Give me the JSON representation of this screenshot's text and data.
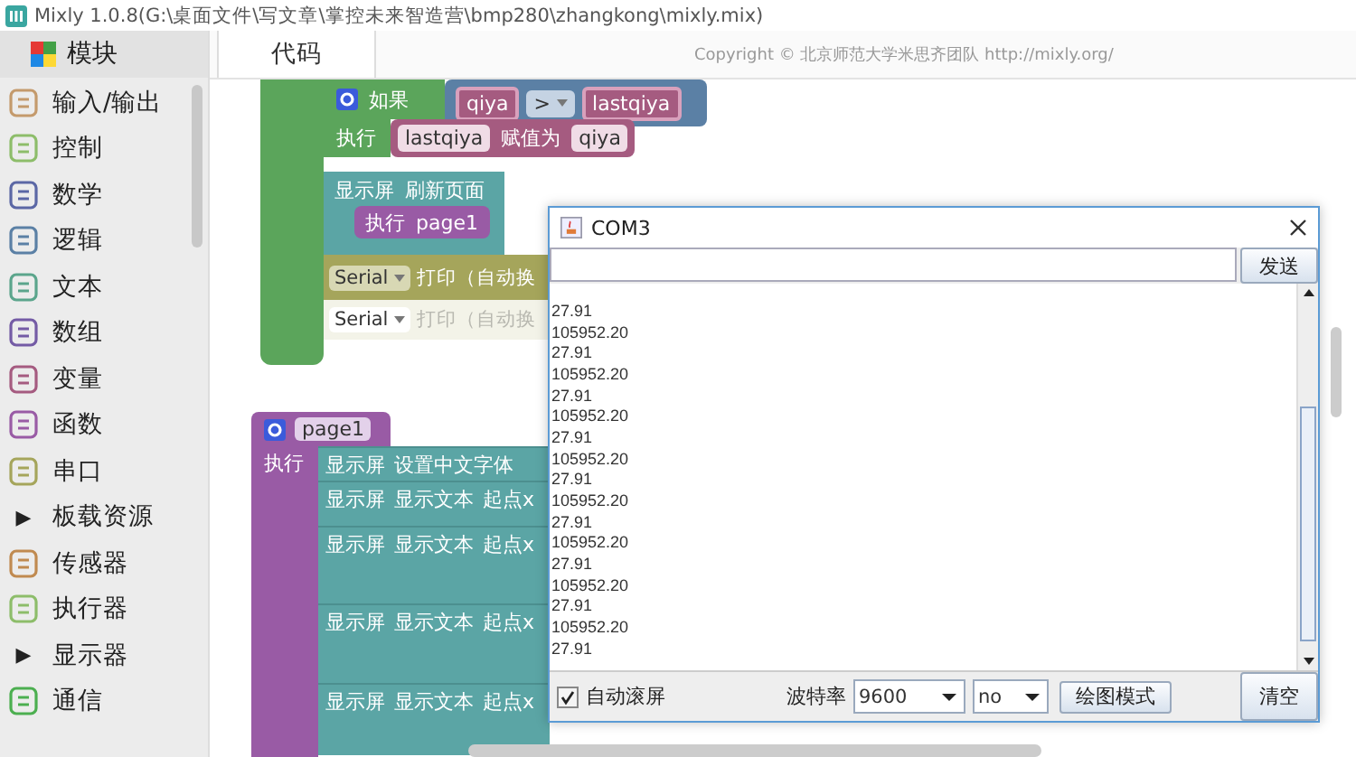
{
  "window": {
    "title": "Mixly 1.0.8(G:\\桌面文件\\写文章\\掌控未来智造营\\bmp280\\zhangkong\\mixly.mix)"
  },
  "sidebar": {
    "header": "模块",
    "items": [
      {
        "label": "输入/输出",
        "kind": "category",
        "color": "#c49a6c"
      },
      {
        "label": "控制",
        "kind": "category",
        "color": "#8dbd6a"
      },
      {
        "label": "数学",
        "kind": "category",
        "color": "#5b67a5"
      },
      {
        "label": "逻辑",
        "kind": "category",
        "color": "#5b80a5"
      },
      {
        "label": "文本",
        "kind": "category",
        "color": "#5ba58c"
      },
      {
        "label": "数组",
        "kind": "category",
        "color": "#745ba5"
      },
      {
        "label": "变量",
        "kind": "category",
        "color": "#a55b80"
      },
      {
        "label": "函数",
        "kind": "category",
        "color": "#995ba5"
      },
      {
        "label": "串口",
        "kind": "category",
        "color": "#a5a55b"
      },
      {
        "label": "板载资源",
        "kind": "folder",
        "arrow": "▶"
      },
      {
        "label": "传感器",
        "kind": "category",
        "color": "#c08a50"
      },
      {
        "label": "执行器",
        "kind": "category",
        "color": "#8dbd6a"
      },
      {
        "label": "显示器",
        "kind": "folder",
        "arrow": "▶"
      },
      {
        "label": "通信",
        "kind": "category",
        "color": "#4caf50"
      }
    ]
  },
  "tabs": [
    {
      "label": "代码",
      "selected": true
    }
  ],
  "copyright": "Copyright © 北京师范大学米思齐团队 http://mixly.org/",
  "workspace": {
    "if_block": {
      "keyword": "如果",
      "left": "qiya",
      "op": ">",
      "right": "lastqiya",
      "do_label": "执行",
      "assign_var": "lastqiya",
      "assign_word": "赋值为",
      "assign_value": "qiya"
    },
    "refresh_block": {
      "device": "显示屏",
      "action": "刷新页面",
      "call_label": "执行",
      "call_name": "page1"
    },
    "serial_blocks": [
      {
        "port": "Serial",
        "action": "打印（自动换",
        "disabled": false
      },
      {
        "port": "Serial",
        "action": "打印（自动换",
        "disabled": true
      }
    ],
    "procedure": {
      "name": "page1",
      "do_label": "执行",
      "statements": [
        {
          "device": "显示屏",
          "action": "设置中文字体"
        },
        {
          "device": "显示屏",
          "action": "显示文本",
          "arg": "起点x"
        },
        {
          "device": "显示屏",
          "action": "显示文本",
          "arg": "起点x"
        },
        {
          "device": "显示屏",
          "action": "显示文本",
          "arg": "起点x"
        },
        {
          "device": "显示屏",
          "action": "显示文本",
          "arg": "起点x"
        }
      ]
    }
  },
  "serial_monitor": {
    "title": "COM3",
    "send_button": "发送",
    "output": [
      "27.91",
      "105952.20",
      "27.91",
      "105952.20",
      "27.91",
      "105952.20",
      "27.91",
      "105952.20",
      "27.91",
      "105952.20",
      "27.91",
      "105952.20",
      "27.91",
      "105952.20",
      "27.91",
      "105952.20",
      "27.91"
    ],
    "autoscroll": {
      "label": "自动滚屏",
      "checked": true
    },
    "baud_label": "波特率",
    "baud": "9600",
    "parity": "no",
    "plot_button": "绘图模式",
    "clear_button": "清空"
  }
}
